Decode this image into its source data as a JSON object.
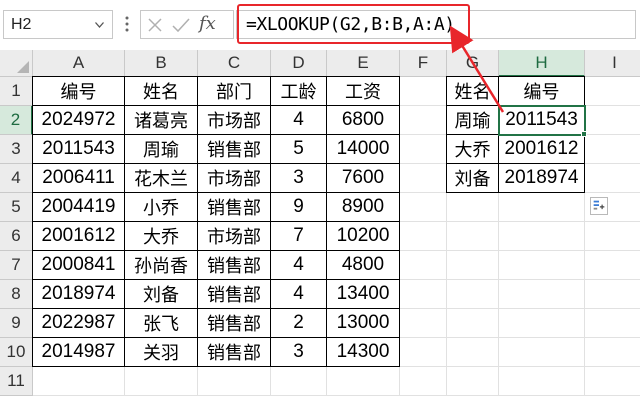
{
  "formula_bar": {
    "name_box": "H2",
    "fx_label": "fx",
    "formula": "=XLOOKUP(G2,B:B,A:A)"
  },
  "sheet": {
    "columns": [
      "A",
      "B",
      "C",
      "D",
      "E",
      "F",
      "G",
      "H",
      "I"
    ],
    "rows": [
      "1",
      "2",
      "3",
      "4",
      "5",
      "6",
      "7",
      "8",
      "9",
      "10",
      "11"
    ],
    "selected_column": "H",
    "selected_row": "2",
    "table_main": {
      "headers": [
        "编号",
        "姓名",
        "部门",
        "工龄",
        "工资"
      ],
      "rows": [
        [
          "2024972",
          "诸葛亮",
          "市场部",
          "4",
          "6800"
        ],
        [
          "2011543",
          "周瑜",
          "销售部",
          "5",
          "14000"
        ],
        [
          "2006411",
          "花木兰",
          "市场部",
          "3",
          "7600"
        ],
        [
          "2004419",
          "小乔",
          "销售部",
          "9",
          "8900"
        ],
        [
          "2001612",
          "大乔",
          "市场部",
          "7",
          "10200"
        ],
        [
          "2000841",
          "孙尚香",
          "销售部",
          "4",
          "4800"
        ],
        [
          "2018974",
          "刘备",
          "销售部",
          "4",
          "13400"
        ],
        [
          "2022987",
          "张飞",
          "销售部",
          "2",
          "13000"
        ],
        [
          "2014987",
          "关羽",
          "销售部",
          "3",
          "14300"
        ]
      ]
    },
    "table_lookup": {
      "headers": [
        "姓名",
        "编号"
      ],
      "rows": [
        [
          "周瑜",
          "2011543"
        ],
        [
          "大乔",
          "2001612"
        ],
        [
          "刘备",
          "2018974"
        ]
      ]
    }
  },
  "colors": {
    "highlight_red": "#e8262b",
    "selection_green": "#217346"
  },
  "icons": [
    "dropdown-arrow-icon",
    "more-options-icon",
    "cancel-icon",
    "enter-icon",
    "fx-icon",
    "quick-analysis-icon"
  ]
}
